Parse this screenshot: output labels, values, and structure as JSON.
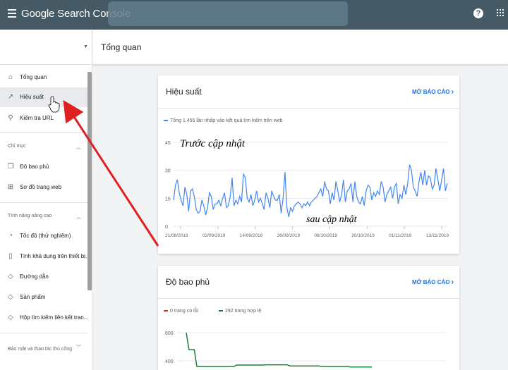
{
  "app": {
    "title": "Google Search Console",
    "search_placeholder": "",
    "help_icon": "help-icon",
    "apps_icon": "apps-grid-icon"
  },
  "sidebar": {
    "items": [
      {
        "label": "Tổng quan",
        "icon": "home-icon"
      },
      {
        "label": "Hiệu suất",
        "icon": "trending-up-icon",
        "active": true
      },
      {
        "label": "Kiểm tra URL",
        "icon": "search-icon"
      }
    ],
    "sections": [
      {
        "title": "Chỉ mục",
        "items": [
          {
            "label": "Độ bao phủ",
            "icon": "file-copy-icon"
          },
          {
            "label": "Sơ đồ trang web",
            "icon": "sitemap-icon"
          }
        ]
      },
      {
        "title": "Tính năng nâng cao",
        "items": [
          {
            "label": "Tốc độ (thử nghiệm)",
            "icon": "speed-icon"
          },
          {
            "label": "Tính khả dụng trên thiết bị...",
            "icon": "phone-icon"
          },
          {
            "label": "Đường dẫn",
            "icon": "diamond-icon"
          },
          {
            "label": "Sản phẩm",
            "icon": "diamond-icon"
          },
          {
            "label": "Hộp tìm kiếm liên kết tran...",
            "icon": "diamond-icon"
          }
        ]
      },
      {
        "title": "Bảo mật và thao tác thủ công",
        "items": []
      }
    ]
  },
  "header": {
    "title": "Tổng quan"
  },
  "performance_card": {
    "title": "Hiệu suất",
    "link": "MỞ BÁO CÁO",
    "legend": "Tổng 1.455 lần nhấp vào kết quả tìm kiếm trên web",
    "annotation_before": "Trước cập nhật",
    "annotation_after": "sau cập nhật",
    "series_color": "#4285f4"
  },
  "coverage_card": {
    "title": "Độ bao phủ",
    "link": "MỞ BÁO CÁO",
    "legend_error": "0 trang có lỗi",
    "legend_valid": "292 trang hợp lệ",
    "error_color": "#d93025",
    "valid_color": "#188038"
  },
  "chart_data": [
    {
      "type": "line",
      "title": "",
      "series": [
        {
          "name": "Tổng 1.455 lần nhấp vào kết quả tìm kiếm trên web",
          "values": [
            14,
            22,
            25,
            18,
            14,
            11,
            21,
            17,
            8,
            19,
            20,
            16,
            9,
            7,
            8,
            14,
            11,
            6,
            10,
            18,
            16,
            9,
            12,
            12,
            14,
            11,
            15,
            18,
            10,
            11,
            16,
            26,
            11,
            14,
            12,
            16,
            13,
            28,
            26,
            15,
            13,
            17,
            11,
            14,
            19,
            13,
            15,
            12,
            9,
            18,
            15,
            10,
            19,
            16,
            14,
            14,
            17,
            7,
            15,
            29,
            10,
            5,
            10,
            8,
            11,
            12,
            13,
            12,
            10,
            12,
            11,
            13,
            11,
            13,
            14,
            15,
            16,
            18,
            20,
            16,
            24,
            20,
            19,
            12,
            18,
            14,
            24,
            19,
            13,
            17,
            25,
            13,
            19,
            20,
            23,
            13,
            24,
            16,
            13,
            12,
            16,
            11,
            19,
            22,
            21,
            14,
            18,
            16,
            19,
            17,
            24,
            21,
            13,
            17,
            19,
            21,
            15,
            21,
            23,
            12,
            17,
            15,
            22,
            17,
            23,
            33,
            30,
            21,
            19,
            16,
            24,
            29,
            22,
            30,
            22,
            27,
            26,
            20,
            22,
            31,
            25,
            19,
            25,
            31,
            19,
            23
          ]
        }
      ],
      "x_ticks": [
        "21/08/2019",
        "02/09/2019",
        "14/09/2019",
        "26/09/2019",
        "08/10/2019",
        "20/10/2019",
        "01/11/2019",
        "13/11/2019"
      ],
      "y_ticks": [
        0,
        15,
        30,
        45
      ],
      "ylim": [
        0,
        45
      ],
      "grid": true
    },
    {
      "type": "line",
      "title": "",
      "series": [
        {
          "name": "292 trang hợp lệ",
          "values": [
            600,
            480,
            480,
            480,
            360,
            360,
            360,
            360,
            360,
            360,
            360,
            360,
            360,
            360,
            360,
            360,
            360,
            360,
            360,
            370,
            370,
            370,
            370,
            370,
            370,
            370,
            370,
            370,
            370,
            370,
            372,
            372,
            372,
            372,
            372,
            372,
            372,
            372,
            372,
            364,
            364,
            364,
            364,
            364,
            364,
            364,
            364,
            364,
            364,
            364,
            364,
            360,
            360,
            360,
            360,
            360,
            360,
            360,
            360,
            360,
            360,
            360,
            356,
            356,
            356,
            356,
            356,
            356,
            356,
            356,
            356
          ]
        },
        {
          "name": "0 trang có lỗi",
          "values": []
        }
      ],
      "y_ticks": [
        400,
        600
      ],
      "grid": true
    }
  ]
}
